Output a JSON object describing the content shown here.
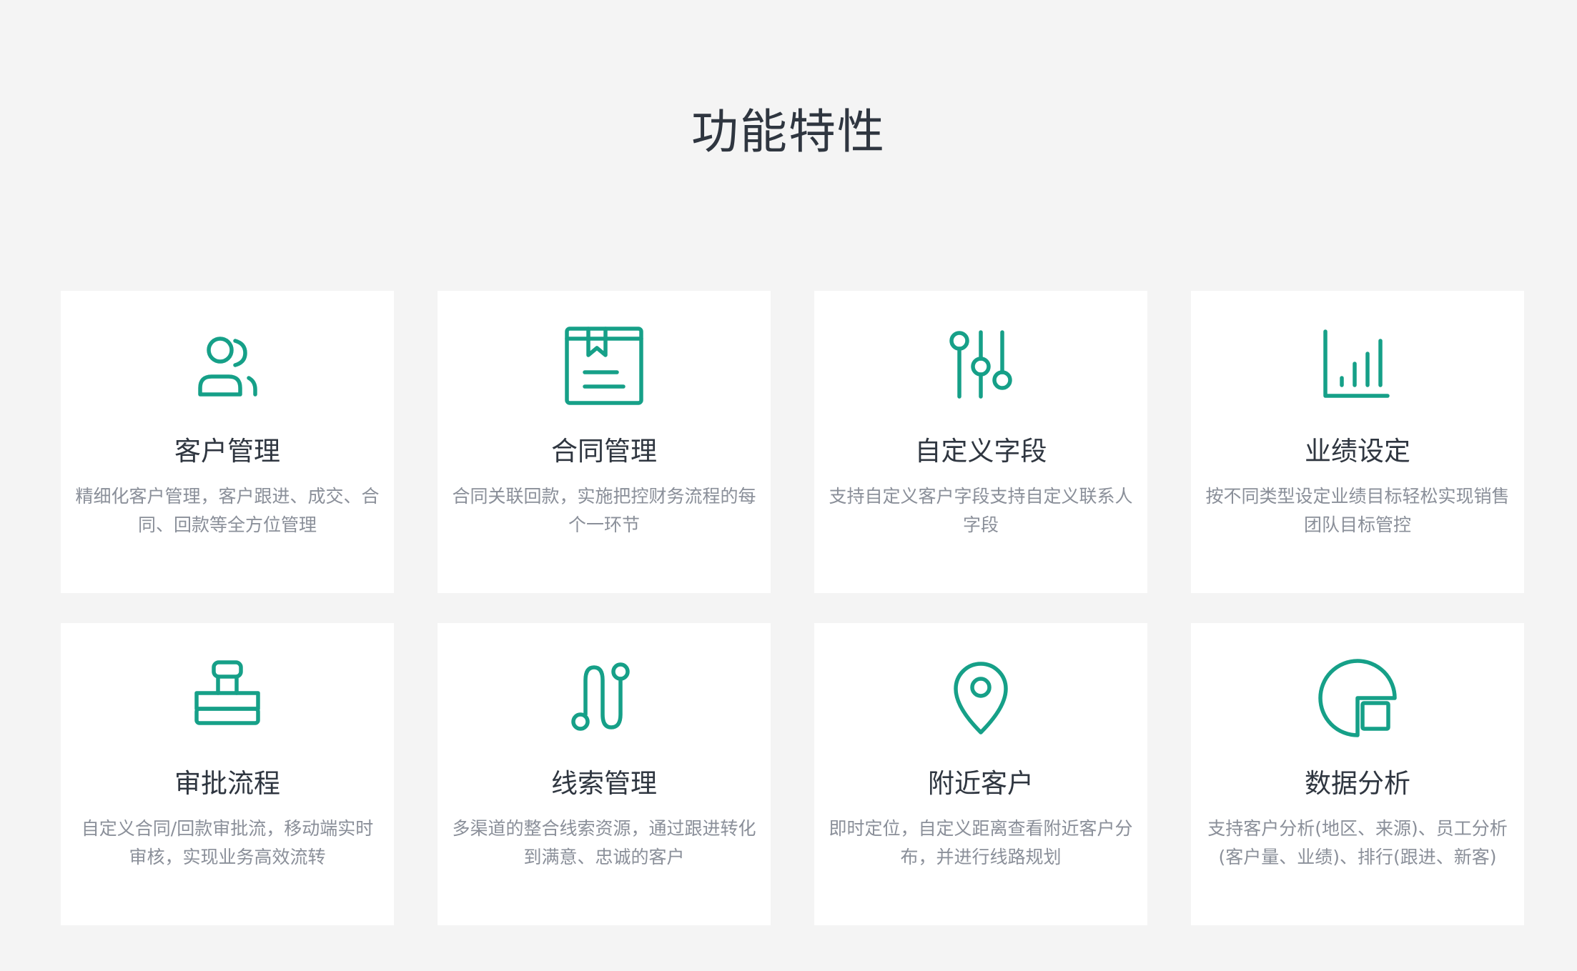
{
  "section": {
    "title": "功能特性"
  },
  "colors": {
    "accent": "#16a088",
    "background": "#f4f4f4",
    "card": "#ffffff",
    "title_text": "#2f3640",
    "desc_text": "#8a8f99"
  },
  "features": [
    {
      "icon": "users-icon",
      "title": "客户管理",
      "desc": "精细化客户管理，客户跟进、成交、合同、回款等全方位管理"
    },
    {
      "icon": "contract-book-icon",
      "title": "合同管理",
      "desc": "合同关联回款，实施把控财务流程的每个一环节"
    },
    {
      "icon": "sliders-icon",
      "title": "自定义字段",
      "desc": "支持自定义客户字段支持自定义联系人字段"
    },
    {
      "icon": "bar-chart-icon",
      "title": "业绩设定",
      "desc": "按不同类型设定业绩目标轻松实现销售团队目标管控"
    },
    {
      "icon": "stamp-icon",
      "title": "审批流程",
      "desc": "自定义合同/回款审批流，移动端实时审核，实现业务高效流转"
    },
    {
      "icon": "route-icon",
      "title": "线索管理",
      "desc": "多渠道的整合线索资源，通过跟进转化到满意、忠诚的客户"
    },
    {
      "icon": "location-pin-icon",
      "title": "附近客户",
      "desc": "即时定位，自定义距离查看附近客户分布，并进行线路规划"
    },
    {
      "icon": "pie-chart-icon",
      "title": "数据分析",
      "desc": "支持客户分析(地区、来源)、员工分析(客户量、业绩)、排行(跟进、新客)"
    }
  ]
}
